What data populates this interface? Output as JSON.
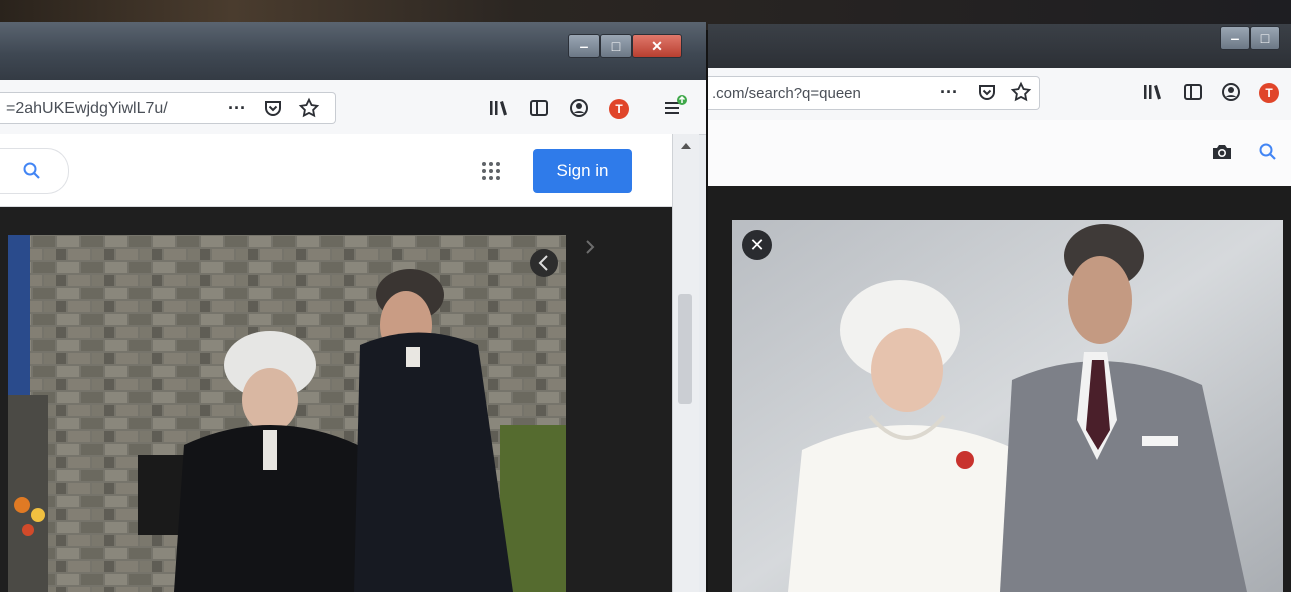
{
  "left_window": {
    "controls": {
      "minimize": "‒",
      "maximize": "□",
      "close": "✕"
    },
    "url": "=2ahUKEwjdgYiwlL7u/",
    "nav_icons": [
      "more-icon",
      "pocket-icon",
      "star-icon",
      "library-icon",
      "sidebar-icon",
      "account-icon",
      "t-extension-icon",
      "menu-icon"
    ],
    "more_label": "···",
    "extension_letter": "T",
    "signin_label": "Sign in"
  },
  "right_window": {
    "controls": {
      "minimize": "‒",
      "maximize": "□"
    },
    "url": ".com/search?q=queen",
    "more_label": "···",
    "extension_letter": "T",
    "close_label": "✕"
  },
  "colors": {
    "signin_blue": "#2f7bea",
    "extension_red": "#e0452a"
  }
}
